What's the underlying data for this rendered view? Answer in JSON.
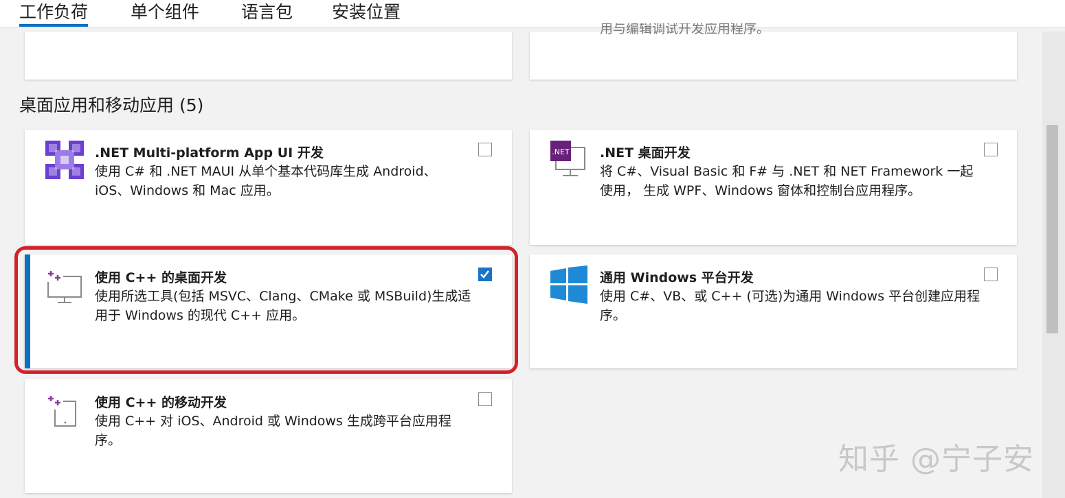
{
  "tabs": [
    {
      "label": "工作负荷"
    },
    {
      "label": "单个组件"
    },
    {
      "label": "语言包"
    },
    {
      "label": "安装位置"
    }
  ],
  "top_partial_text": "用与编辑调试开发应用程序。",
  "section": {
    "title": "桌面应用和移动应用 (5)"
  },
  "workloads": [
    {
      "title": ".NET Multi-platform App UI 开发",
      "desc": "使用 C# 和 .NET MAUI 从单个基本代码库生成 Android、iOS、Windows 和 Mac 应用。",
      "checked": false,
      "icon": "maui-icon"
    },
    {
      "title": ".NET 桌面开发",
      "desc": "将 C#、Visual Basic 和 F# 与 .NET 和 NET Framework 一起使用， 生成 WPF、Windows 窗体和控制台应用程序。",
      "checked": false,
      "icon": "dotnet-desktop-icon",
      "badge": ".NET"
    },
    {
      "title": "使用 C++ 的桌面开发",
      "desc": "使用所选工具(包括 MSVC、Clang、CMake 或 MSBuild)生成适用于 Windows 的现代 C++ 应用。",
      "checked": true,
      "icon": "cpp-desktop-icon"
    },
    {
      "title": "通用 Windows 平台开发",
      "desc": "使用 C#、VB、或 C++ (可选)为通用 Windows 平台创建应用程序。",
      "checked": false,
      "icon": "windows-logo-icon"
    },
    {
      "title": "使用 C++ 的移动开发",
      "desc": "使用 C++ 对 iOS、Android 或 Windows 生成跨平台应用程序。",
      "checked": false,
      "icon": "cpp-mobile-icon"
    }
  ],
  "watermark": "知乎 @宁子安",
  "colors": {
    "accent": "#0e70c0",
    "highlight": "#d4212a",
    "checkbox_on": "#1a73c8",
    "maui": "#6b3fd1",
    "dotnet": "#68217a",
    "windows": "#1e8ad6"
  }
}
